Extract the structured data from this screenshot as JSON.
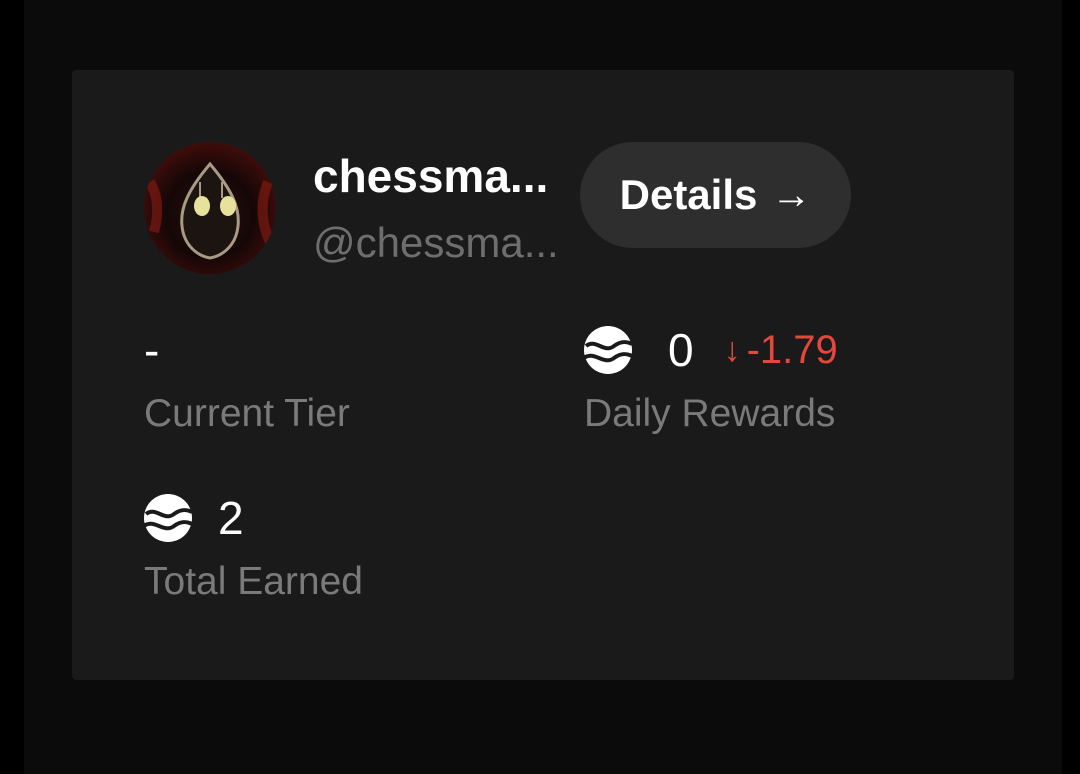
{
  "profile": {
    "display_name": "chessma...",
    "handle": "@chessma...",
    "details_label": "Details",
    "details_arrow": "→"
  },
  "stats": {
    "current_tier": {
      "value": "-",
      "label": "Current Tier"
    },
    "daily_rewards": {
      "value": "0",
      "change_arrow": "↓",
      "change": "-1.79",
      "label": "Daily Rewards"
    },
    "total_earned": {
      "value": "2",
      "label": "Total Earned"
    }
  },
  "colors": {
    "background": "#0b0b0b",
    "card": "#1a1a1a",
    "button": "#2e2e2e",
    "text_primary": "#ffffff",
    "text_secondary": "#7a7a7a",
    "negative": "#e5483b"
  }
}
